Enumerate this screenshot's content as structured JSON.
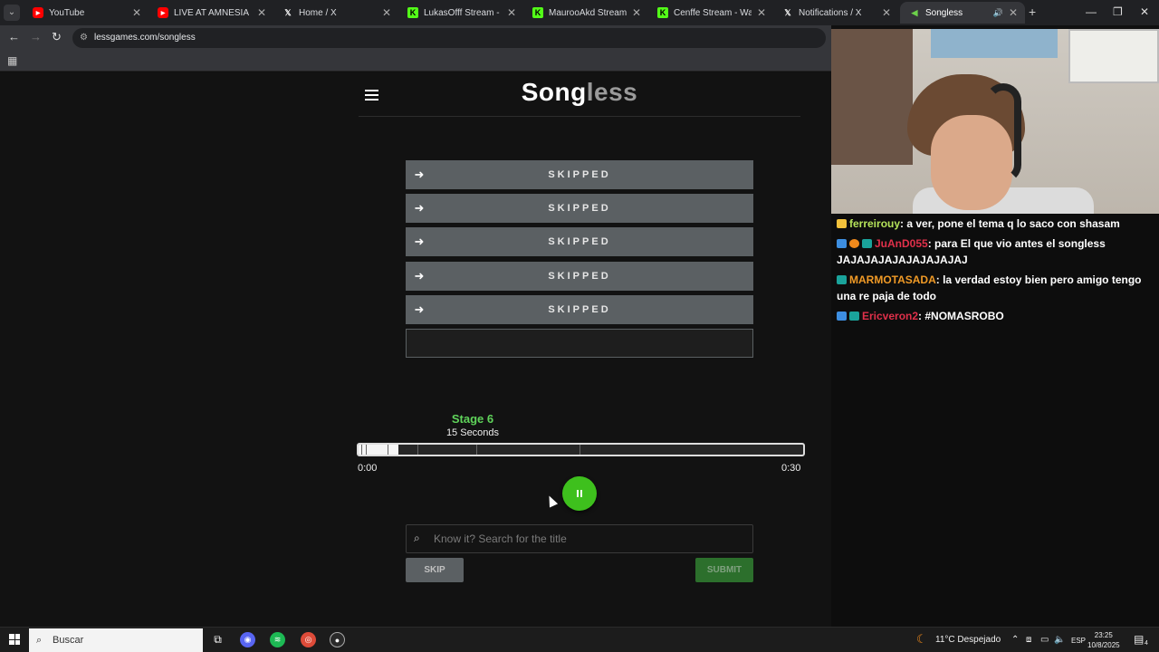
{
  "browser": {
    "tabs": [
      {
        "title": "YouTube",
        "favicon": "youtube-icon"
      },
      {
        "title": "LIVE AT AMNESIA IBIZA | ...",
        "favicon": "youtube-icon"
      },
      {
        "title": "Home / X",
        "favicon": "x-icon"
      },
      {
        "title": "LukasOfff Stream - Watch ...",
        "favicon": "kick-icon"
      },
      {
        "title": "MaurooAkd Stream - Watc...",
        "favicon": "kick-icon"
      },
      {
        "title": "Cenffe Stream - Watch Liv...",
        "favicon": "kick-icon"
      },
      {
        "title": "Notifications / X",
        "favicon": "x-icon"
      },
      {
        "title": "Songless",
        "favicon": "songless-icon",
        "active": true
      }
    ],
    "url": "lessgames.com/songless"
  },
  "game": {
    "logo_main": "Song",
    "logo_accent": "less",
    "guesses": [
      "SKIPPED",
      "SKIPPED",
      "SKIPPED",
      "SKIPPED",
      "SKIPPED"
    ],
    "stage_label": "Stage 6",
    "seconds_label": "15 Seconds",
    "time_start": "0:00",
    "time_end": "0:30",
    "progress_fraction": 0.09,
    "search_placeholder": "Know it? Search for the title",
    "skip_label": "SKIP",
    "submit_label": "SUBMIT"
  },
  "chat": {
    "messages": [
      {
        "user": "ferreirouy",
        "user_color": "#b5e35a",
        "text": ": a ver, pone el tema q lo saco con shasam"
      },
      {
        "user": "JuAnD055",
        "user_color": "#e0304a",
        "text": ": para El que vio antes el songless JAJAJAJAJAJAJAJAJAJ"
      },
      {
        "user": "MARMOTASADA",
        "user_color": "#f09a26",
        "text": ": la verdad estoy bien pero amigo tengo una re paja de todo"
      },
      {
        "user": "Ericveron2",
        "user_color": "#e0304a",
        "text": ": #NOMASROBO"
      }
    ]
  },
  "taskbar": {
    "search_placeholder": "Buscar",
    "weather": "11°C  Despejado",
    "language": "ESP",
    "time": "23:25",
    "date": "10/8/2025",
    "notification_count": "4"
  }
}
